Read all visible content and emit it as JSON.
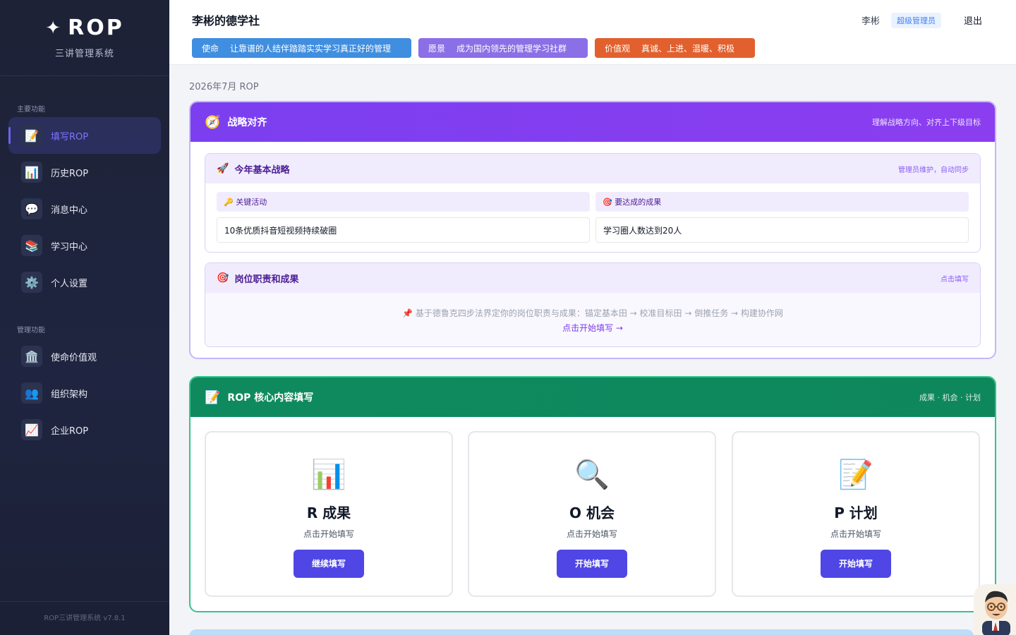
{
  "sidebar": {
    "brand_title": "ROP",
    "brand_subtitle": "三讲管理系统",
    "section_main": "主要功能",
    "main_items": [
      {
        "label": "填写ROP",
        "icon": "📝"
      },
      {
        "label": "历史ROP",
        "icon": "📊"
      },
      {
        "label": "消息中心",
        "icon": "💬"
      },
      {
        "label": "学习中心",
        "icon": "📚"
      },
      {
        "label": "个人设置",
        "icon": "⚙️"
      }
    ],
    "section_admin": "管理功能",
    "admin_items": [
      {
        "label": "使命价值观",
        "icon": "🏛️"
      },
      {
        "label": "组织架构",
        "icon": "👥"
      },
      {
        "label": "企业ROP",
        "icon": "📈"
      }
    ],
    "version": "ROP三讲管理系统 v7.8.1"
  },
  "header": {
    "org_name": "李彬的德学社",
    "user_name": "李彬",
    "role": "超级管理员",
    "logout": "退出",
    "mission_key": "使命",
    "mission_value": "让靠谱的人结伴踏踏实实学习真正好的管理",
    "vision_key": "愿景",
    "vision_value": "成为国内领先的管理学习社群",
    "values_key": "价值观",
    "values_value": "真诚、上进、温暖、积极"
  },
  "period": "2026年7月 ROP",
  "strategy": {
    "icon": "🧭",
    "title": "战略对齐",
    "hint": "理解战略方向、对齐上下级目标",
    "annual": {
      "icon": "🚀",
      "title": "今年基本战略",
      "hint": "管理员维护，自动同步",
      "activities_label": "🔑 关键活动",
      "activities_value": "10条优质抖音短视频持续破圈",
      "results_label": "🎯 要达成的成果",
      "results_value": "学习圈人数达到20人"
    },
    "duty": {
      "icon": "🎯",
      "title": "岗位职责和成果",
      "hint": "点击填写",
      "desc": "📌 基于德鲁克四步法界定你的岗位职责与成果：锚定基本田 → 校准目标田 → 倒推任务 → 构建协作网",
      "link": "点击开始填写 →"
    }
  },
  "rop": {
    "icon": "📝",
    "title": "ROP 核心内容填写",
    "hint": "成果 · 机会 · 计划",
    "cards": [
      {
        "icon": "📊",
        "title": "R 成果",
        "subtitle": "点击开始填写",
        "button": "继续填写"
      },
      {
        "icon": "🔍",
        "title": "O 机会",
        "subtitle": "点击开始填写",
        "button": "开始填写"
      },
      {
        "icon": "📝",
        "title": "P 计划",
        "subtitle": "点击开始填写",
        "button": "开始填写"
      }
    ]
  },
  "colors": {
    "accent": "#4f46e5",
    "strategy_header": "#7b3ff0",
    "rop_header": "#0f8a5f",
    "mission_chip": "#3f8ee0",
    "vision_chip": "#8b6fe6",
    "values_chip": "#e2602d"
  }
}
